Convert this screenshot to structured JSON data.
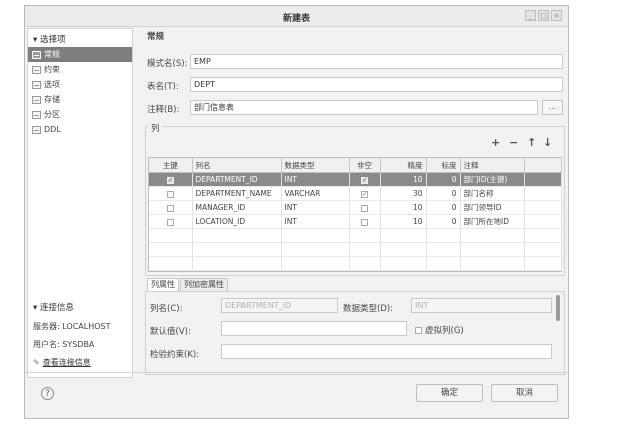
{
  "window": {
    "title": "新建表",
    "controls": {
      "minimize": "_",
      "maximize": "□",
      "close": "×"
    }
  },
  "sidebar": {
    "options_header": "▾ 选择项",
    "items": [
      {
        "label": "常规",
        "selected": true
      },
      {
        "label": "约束",
        "selected": false
      },
      {
        "label": "选项",
        "selected": false
      },
      {
        "label": "存储",
        "selected": false
      },
      {
        "label": "分区",
        "selected": false
      },
      {
        "label": "DDL",
        "selected": false
      }
    ],
    "connection_header": "▾ 连接信息",
    "server_label": "服务器: LOCALHOST",
    "user_label": "用户名: SYSDBA",
    "view_link": "查看连接信息"
  },
  "main": {
    "section_title": "常规",
    "schema_label": "模式名(S):",
    "schema_value": "EMP",
    "table_label": "表名(T):",
    "table_value": "DEPT",
    "comment_label": "注释(B):",
    "comment_value": "部门信息表",
    "comment_button": "...",
    "columns_group": "列",
    "toolbar": {
      "add": "+",
      "remove": "−",
      "up": "↑",
      "down": "↓"
    },
    "table": {
      "headers": [
        "主键",
        "列名",
        "数据类型",
        "非空",
        "精度",
        "标度",
        "注释"
      ],
      "rows": [
        {
          "pk": true,
          "name": "DEPARTMENT_ID",
          "type": "INT",
          "notnull": true,
          "precision": "10",
          "scale": "0",
          "comment": "部门ID(主键)",
          "selected": true
        },
        {
          "pk": false,
          "name": "DEPARTMENT_NAME",
          "type": "VARCHAR",
          "notnull": true,
          "precision": "30",
          "scale": "0",
          "comment": "部门名称",
          "selected": false
        },
        {
          "pk": false,
          "name": "MANAGER_ID",
          "type": "INT",
          "notnull": false,
          "precision": "10",
          "scale": "0",
          "comment": "部门领导ID",
          "selected": false
        },
        {
          "pk": false,
          "name": "LOCATION_ID",
          "type": "INT",
          "notnull": false,
          "precision": "10",
          "scale": "0",
          "comment": "部门所在地ID",
          "selected": false
        }
      ]
    },
    "tabs": [
      "列属性",
      "列加密属性"
    ],
    "props": {
      "colname_label": "列名(C):",
      "colname_value": "DEPARTMENT_ID",
      "datatype_label": "数据类型(D):",
      "datatype_value": "INT",
      "default_label": "默认值(V):",
      "virtual_label": "虚拟列(G)",
      "check_label": "检验约束(K):"
    }
  },
  "footer": {
    "help": "?",
    "ok": "确定",
    "cancel": "取消"
  }
}
